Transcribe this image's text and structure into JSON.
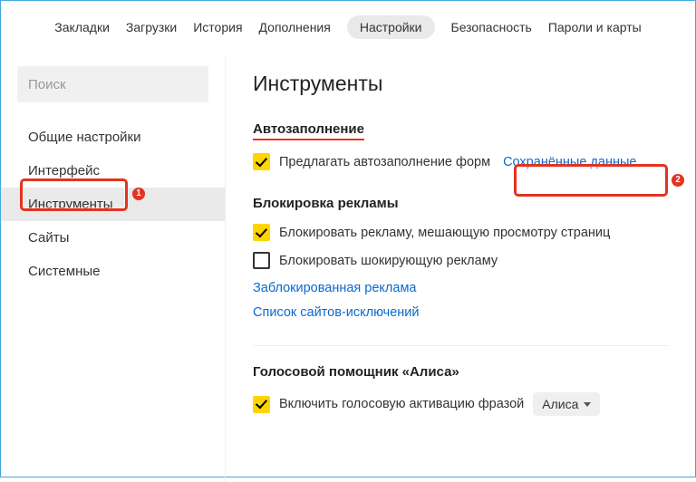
{
  "topnav": {
    "items": [
      {
        "label": "Закладки"
      },
      {
        "label": "Загрузки"
      },
      {
        "label": "История"
      },
      {
        "label": "Дополнения"
      },
      {
        "label": "Настройки",
        "active": true
      },
      {
        "label": "Безопасность"
      },
      {
        "label": "Пароли и карты"
      }
    ]
  },
  "sidebar": {
    "search_placeholder": "Поиск",
    "items": [
      {
        "label": "Общие настройки"
      },
      {
        "label": "Интерфейс"
      },
      {
        "label": "Инструменты",
        "selected": true
      },
      {
        "label": "Сайты"
      },
      {
        "label": "Системные"
      }
    ]
  },
  "page": {
    "title": "Инструменты"
  },
  "autofill": {
    "title": "Автозаполнение",
    "suggest_label": "Предлагать автозаполнение форм",
    "saved_data_link": "Сохранённые данные"
  },
  "adblock": {
    "title": "Блокировка рекламы",
    "block_intrusive_label": "Блокировать рекламу, мешающую просмотру страниц",
    "block_shocking_label": "Блокировать шокирующую рекламу",
    "blocked_link": "Заблокированная реклама",
    "exclusions_link": "Список сайтов-исключений"
  },
  "voice": {
    "title": "Голосовой помощник «Алиса»",
    "enable_label": "Включить голосовую активацию фразой",
    "select_value": "Алиса"
  },
  "annotations": {
    "badge1": "1",
    "badge2": "2"
  }
}
